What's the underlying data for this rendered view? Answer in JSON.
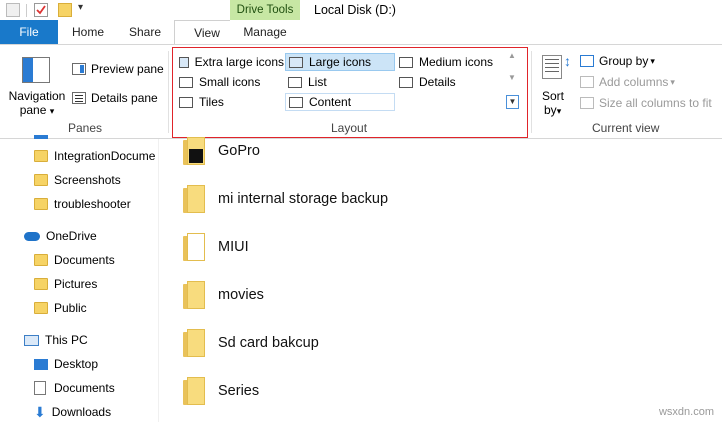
{
  "window": {
    "title": "Local Disk (D:)",
    "context_group": "Drive Tools"
  },
  "tabs": {
    "file": "File",
    "home": "Home",
    "share": "Share",
    "view": "View",
    "manage": "Manage"
  },
  "ribbon": {
    "panes": {
      "navigation_pane_line1": "Navigation",
      "navigation_pane_line2": "pane",
      "preview_pane": "Preview pane",
      "details_pane": "Details pane",
      "group_label": "Panes"
    },
    "layout": {
      "extra_large_icons": "Extra large icons",
      "large_icons": "Large icons",
      "medium_icons": "Medium icons",
      "small_icons": "Small icons",
      "list": "List",
      "details": "Details",
      "tiles": "Tiles",
      "content": "Content",
      "group_label": "Layout",
      "selected": "Large icons"
    },
    "current_view": {
      "sort_line1": "Sort",
      "sort_line2": "by",
      "group_by": "Group by",
      "add_columns": "Add columns",
      "size_all_columns": "Size all columns to fit",
      "group_label": "Current view"
    }
  },
  "nav": {
    "items": [
      {
        "label": "IntegrationDocume",
        "icon": "folder-icon"
      },
      {
        "label": "Screenshots",
        "icon": "folder-icon"
      },
      {
        "label": "troubleshooter",
        "icon": "folder-icon"
      },
      {
        "label": "OneDrive",
        "icon": "onedrive-icon"
      },
      {
        "label": "Documents",
        "icon": "folder-icon"
      },
      {
        "label": "Pictures",
        "icon": "folder-icon"
      },
      {
        "label": "Public",
        "icon": "folder-icon"
      },
      {
        "label": "This PC",
        "icon": "pc-icon"
      },
      {
        "label": "Desktop",
        "icon": "desktop-icon"
      },
      {
        "label": "Documents",
        "icon": "documents-icon"
      },
      {
        "label": "Downloads",
        "icon": "downloads-icon"
      }
    ]
  },
  "content": {
    "items": [
      {
        "label": "GoPro"
      },
      {
        "label": "mi internal storage backup"
      },
      {
        "label": "MIUI"
      },
      {
        "label": "movies"
      },
      {
        "label": "Sd card bakcup"
      },
      {
        "label": "Series"
      }
    ]
  },
  "watermark": "wsxdn.com",
  "colors": {
    "file_tab": "#1979ca",
    "drive_tools": "#c7e7a4",
    "selection": "#cce4f7",
    "highlight_box": "#e0242a",
    "folder": "#f8dc7e"
  }
}
